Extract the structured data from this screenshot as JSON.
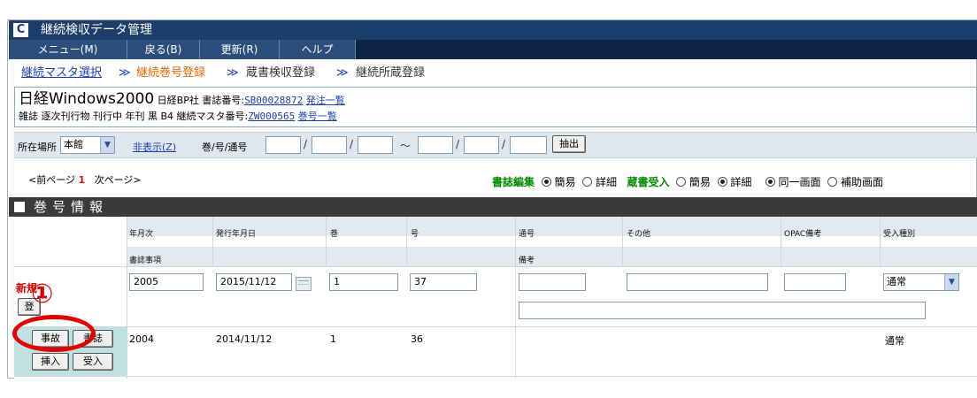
{
  "window": {
    "title": "継続検収データ管理",
    "logo": "C"
  },
  "menu": [
    "メニュー(M)",
    "戻る(B)",
    "更新(R)",
    "ヘルプ"
  ],
  "breadcrumb": {
    "items": [
      "継続マスタ選択",
      "継続巻号登録",
      "蔵書検収登録",
      "継続所蔵登録"
    ],
    "separator": "≫"
  },
  "biblio": {
    "title": "日経Windows2000",
    "publisher": "日経BP社",
    "bib_no_label": "書誌番号:",
    "bib_no": "SB00028872",
    "order_list_link": "発注一覧",
    "line2_text": "雑誌 逐次刊行物 刊行中 年刊 黒 B4 継続マスタ番号:",
    "master_no": "ZW000565",
    "volume_list_link": "巻号一覧"
  },
  "search": {
    "location_label": "所在場所",
    "location_value": "本館",
    "hide_link": "非表示(Z)",
    "volume_label": "巻/号/通号",
    "slash": "/",
    "tilde": "～",
    "extract_button": "抽出"
  },
  "pager": {
    "prev": "<前ページ",
    "current": "1",
    "next": "次ページ>"
  },
  "options": {
    "biblio_edit_label": "書誌編集",
    "simple": "簡易",
    "detail": "詳細",
    "holding_accept_label": "蔵書受入",
    "same_screen": "同一画面",
    "aux_screen": "補助画面"
  },
  "section": {
    "title": "巻号情報"
  },
  "table": {
    "headers": [
      "年月次",
      "発行年月日",
      "巻",
      "号",
      "通号",
      "その他",
      "OPAC備考",
      "受入種別"
    ],
    "sub_headers": {
      "biblio_item": "書誌事項",
      "remarks": "備考"
    },
    "new_row": {
      "label": "新規",
      "register_button": "登",
      "year_month": "2005",
      "issue_date": "2015/11/12",
      "volume": "1",
      "number": "37",
      "accept_type": "通常"
    },
    "rows": [
      {
        "year_month": "2004",
        "issue_date": "2014/11/12",
        "volume": "1",
        "number": "36",
        "accept_type": "通常",
        "buttons": [
          "事故",
          "書誌",
          "挿入",
          "受入"
        ]
      }
    ]
  },
  "annotation": {
    "callout": "①",
    "color": "#e30000"
  }
}
